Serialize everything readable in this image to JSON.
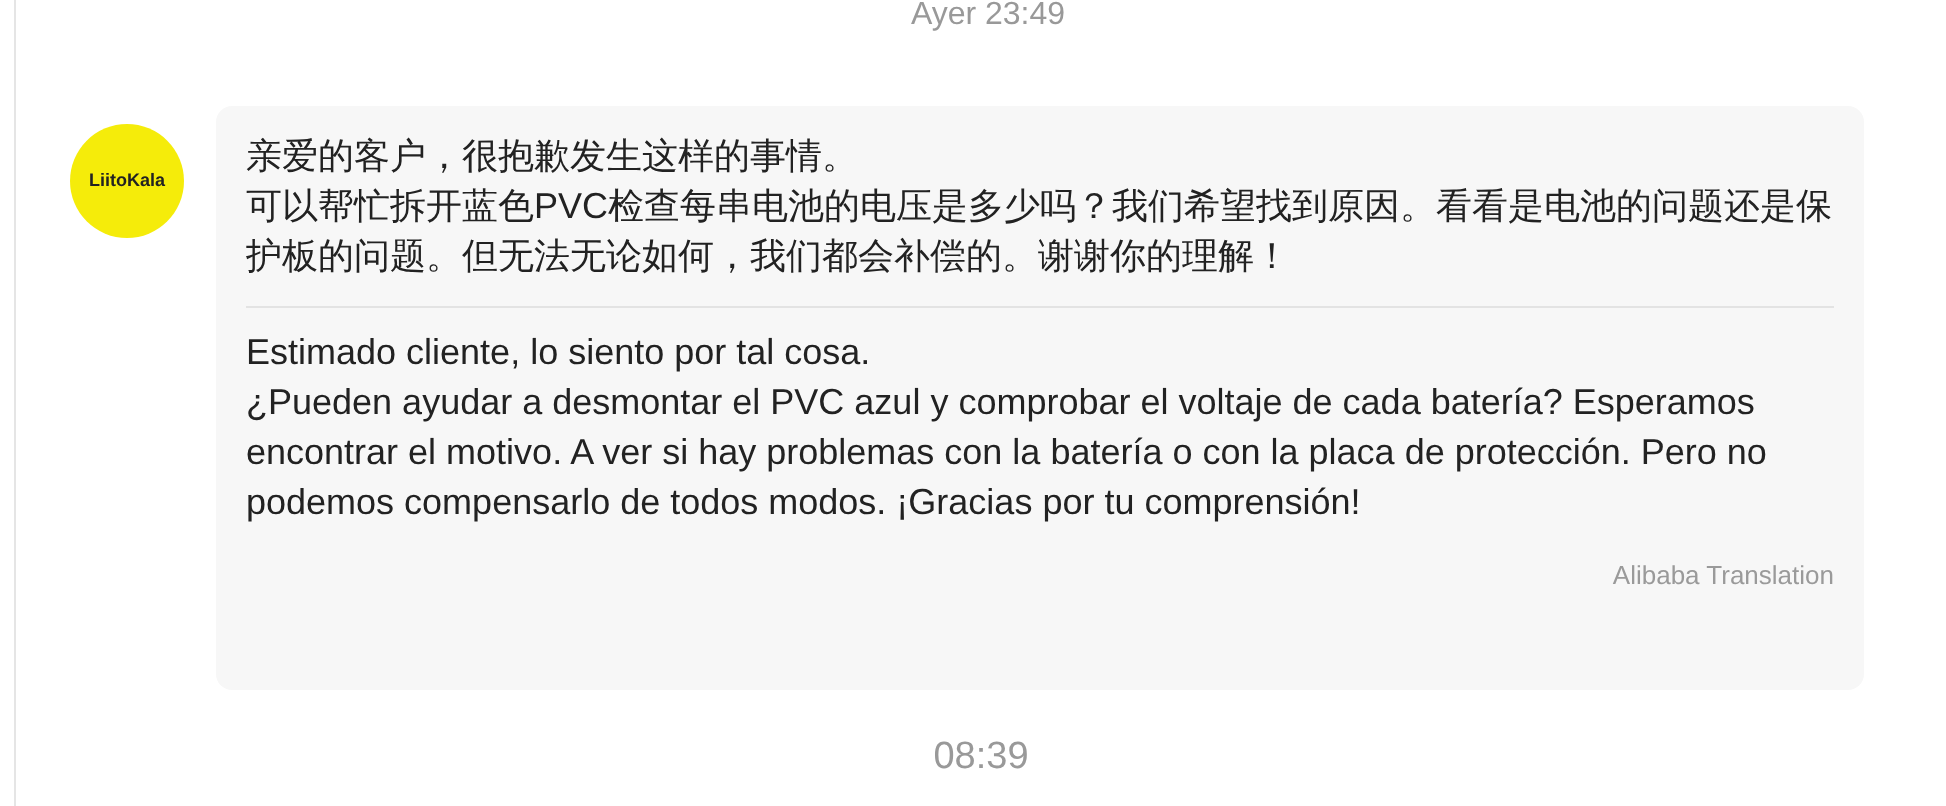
{
  "timestamps_top": "Ayer 23:49",
  "message": {
    "avatar_label": "LiitoKala",
    "original": [
      "亲爱的客户，很抱歉发生这样的事情。",
      "可以帮忙拆开蓝色PVC检查每串电池的电压是多少吗？我们希望找到原因。看看是电池的问题还是保护板的问题。但无法无论如何，我们都会补偿的。谢谢你的理解！"
    ],
    "translation": [
      "Estimado cliente, lo siento por tal cosa.",
      "¿Pueden ayudar a desmontar el PVC azul y comprobar el voltaje de cada batería? Esperamos encontrar el motivo. A ver si hay problemas con la batería o con la placa de protección. Pero no podemos compensarlo de todos modos. ¡Gracias por tu comprensión!"
    ],
    "translation_source": "Alibaba Translation"
  },
  "timestamp_bottom": "08:39"
}
